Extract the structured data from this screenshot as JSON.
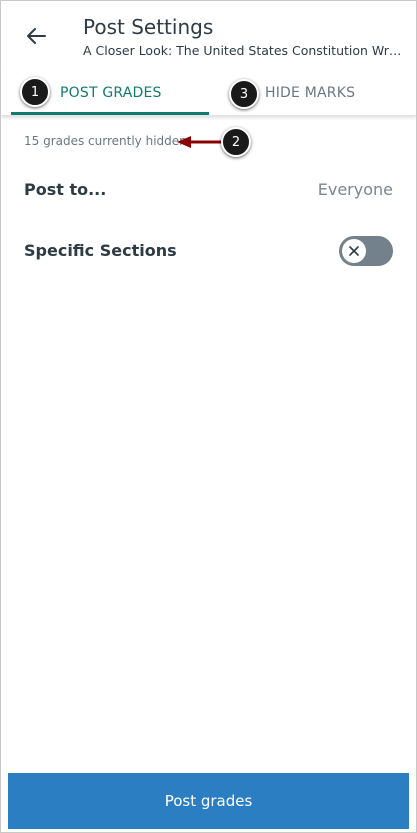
{
  "header": {
    "back_icon": "arrow-left-icon",
    "title": "Post Settings",
    "subtitle": "A Closer Look: The United States  Constitution Written..."
  },
  "tabs": [
    {
      "label": "POST GRADES",
      "selected": true
    },
    {
      "label": "HIDE MARKS",
      "selected": false
    }
  ],
  "callouts": [
    "1",
    "2",
    "3"
  ],
  "content": {
    "hidden_count": "15 grades currently hidden",
    "post_to_label": "Post to...",
    "post_to_value": "Everyone",
    "specific_sections_label": "Specific Sections",
    "specific_sections_on": false
  },
  "footer": {
    "post_button_label": "Post grades"
  },
  "colors": {
    "accent": "#127a6e",
    "button": "#2c7ec2",
    "annotation_arrow": "#8b0000",
    "toggle_off": "#73818c"
  }
}
